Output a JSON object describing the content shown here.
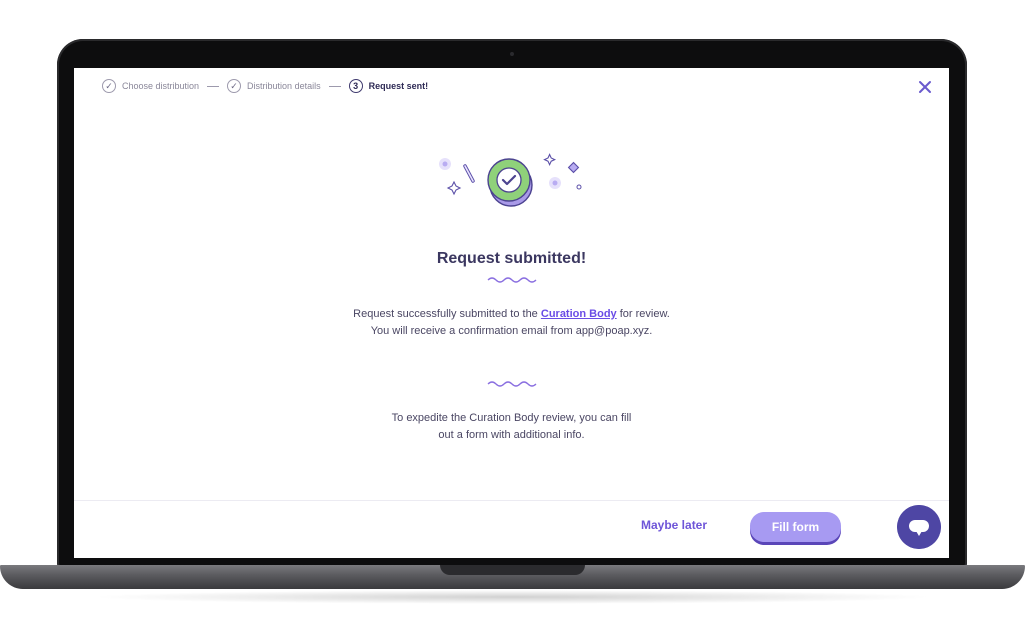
{
  "stepper": {
    "steps": [
      {
        "marker": "✓",
        "label": "Choose distribution",
        "state": "done"
      },
      {
        "marker": "✓",
        "label": "Distribution details",
        "state": "done"
      },
      {
        "marker": "3",
        "label": "Request sent!",
        "state": "active"
      }
    ]
  },
  "close_icon": "close-icon",
  "headline": "Request submitted!",
  "message": {
    "line1_before": "Request successfully submitted to the ",
    "link_text": "Curation Body",
    "line1_after": " for review.",
    "line2": "You will receive a confirmation email from app@poap.xyz."
  },
  "expedite": {
    "line1": "To expedite the Curation Body review, you can fill",
    "line2": "out a form with additional info."
  },
  "actions": {
    "secondary": "Maybe later",
    "primary": "Fill form"
  },
  "colors": {
    "accent": "#6a4ce6",
    "primary_button": "#a79af2",
    "success_badge": "#8fd17a",
    "chat_button": "#4e46a4",
    "heading": "#3b3760"
  }
}
